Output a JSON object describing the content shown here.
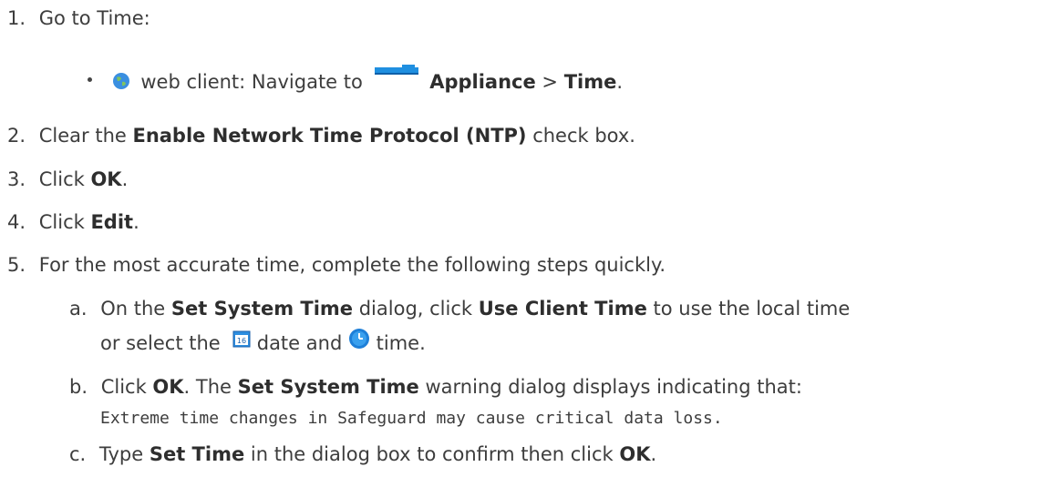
{
  "steps": [
    {
      "num": "1.",
      "text": "Go to Time:"
    },
    {
      "bullet": {
        "icon": "globe-icon",
        "text1": "web client: Navigate to ",
        "icon2": "appliance-icon",
        "bold1": "Appliance",
        "sep": " > ",
        "bold2": "Time",
        "end": "."
      }
    },
    {
      "num": "2.",
      "pre": "Clear the ",
      "bold": "Enable Network Time Protocol (NTP)",
      "post": " check box."
    },
    {
      "num": "3.",
      "pre": "Click ",
      "bold": "OK",
      "post": "."
    },
    {
      "num": "4.",
      "pre": "Click ",
      "bold": "Edit",
      "post": "."
    },
    {
      "num": "5.",
      "text": "For the most accurate time, complete the following steps quickly."
    }
  ],
  "substeps": {
    "a": {
      "num": "a.",
      "pre": "On the ",
      "bold1": "Set System Time",
      "mid": " dialog, click ",
      "bold2": "Use Client Time",
      "post": " to use the local time",
      "line2_pre": "or select the ",
      "calendar_icon": "calendar-icon",
      "line2_mid": " date and ",
      "clock_icon": "clock-icon",
      "line2_post": " time."
    },
    "b": {
      "num": "b.",
      "pre": "Click ",
      "bold1": "OK",
      "mid": ". The ",
      "bold2": "Set System Time",
      "post": " warning dialog displays indicating that:",
      "mono": "Extreme time changes in Safeguard may cause critical data loss."
    },
    "c": {
      "num": "c.",
      "pre": "Type ",
      "bold1": "Set Time",
      "mid": " in the dialog box to confirm then click ",
      "bold2": "OK",
      "post": "."
    }
  },
  "colors": {
    "text": "#3d3d3d",
    "appliance_icon": "#1f8fe0",
    "globe_icon": "#3a8fe0"
  }
}
